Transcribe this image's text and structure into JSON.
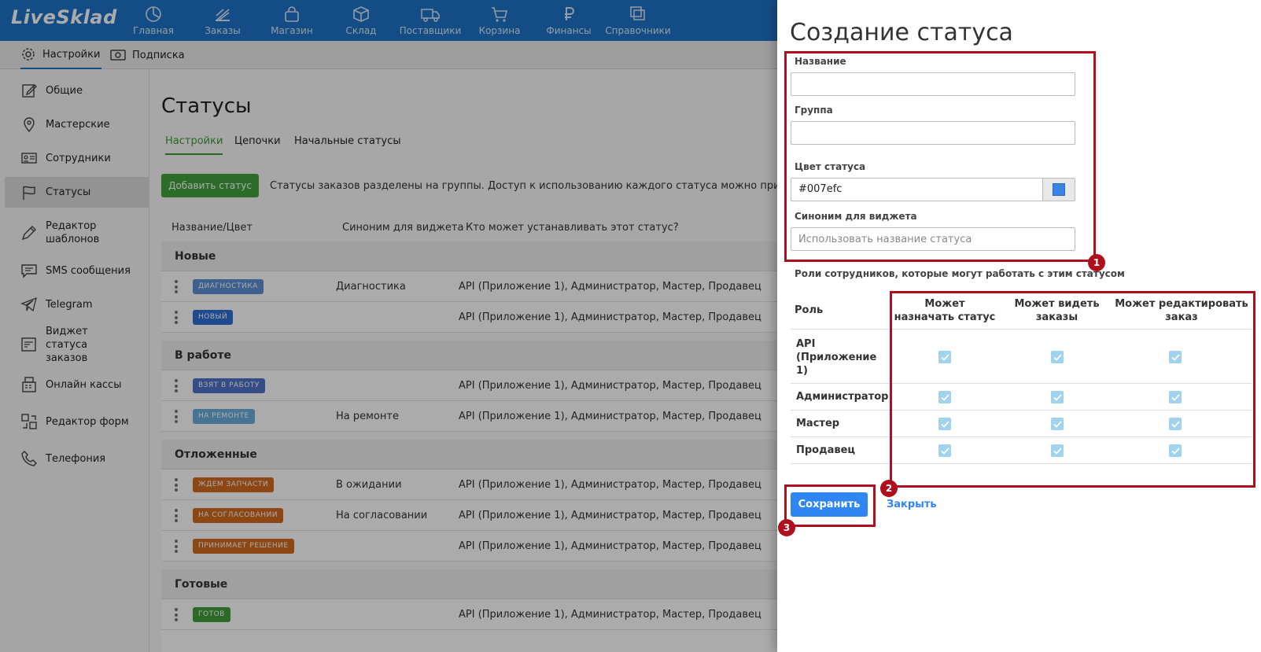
{
  "app": {
    "logo": "LiveSklad"
  },
  "topnav": [
    {
      "label": "Главная",
      "icon": "dashboard-icon"
    },
    {
      "label": "Заказы",
      "icon": "orders-icon"
    },
    {
      "label": "Магазин",
      "icon": "shop-bag-icon"
    },
    {
      "label": "Склад",
      "icon": "warehouse-box-icon"
    },
    {
      "label": "Поставщики",
      "icon": "truck-icon"
    },
    {
      "label": "Корзина",
      "icon": "cart-icon"
    },
    {
      "label": "Финансы",
      "icon": "ruble-icon"
    },
    {
      "label": "Справочники",
      "icon": "catalog-icon"
    }
  ],
  "subnav": [
    {
      "label": "Настройки",
      "icon": "gear-icon"
    },
    {
      "label": "Подписка",
      "icon": "money-icon"
    }
  ],
  "sidebar": [
    {
      "label": "Общие",
      "icon": "edit-icon"
    },
    {
      "label": "Мастерские",
      "icon": "map-pin-icon"
    },
    {
      "label": "Сотрудники",
      "icon": "id-card-icon"
    },
    {
      "label": "Статусы",
      "icon": "flag-icon"
    },
    {
      "label": "Редактор шаблонов",
      "icon": "pencil-icon"
    },
    {
      "label": "SMS сообщения",
      "icon": "message-icon"
    },
    {
      "label": "Telegram",
      "icon": "telegram-icon"
    },
    {
      "label": "Виджет статуса заказов",
      "icon": "widget-icon"
    },
    {
      "label": "Онлайн кассы",
      "icon": "cash-register-icon"
    },
    {
      "label": "Редактор форм",
      "icon": "form-editor-icon"
    },
    {
      "label": "Телефония",
      "icon": "phone-icon"
    }
  ],
  "main": {
    "title": "Статусы",
    "tabs": [
      "Настройки",
      "Цепочки",
      "Начальные статусы"
    ],
    "add_button": "Добавить статус",
    "hint": "Статусы заказов разделены на группы. Доступ к использованию каждого статуса можно привязать к рол",
    "columns": [
      "Название/Цвет",
      "Синоним для виджета",
      "Кто может устанавливать этот статус?"
    ],
    "groups": [
      {
        "name": "Новые",
        "rows": [
          {
            "badge": "ДИАГНОСТИКА",
            "color": "#5b8fd6",
            "synonym": "Диагностика",
            "who": "API (Приложение 1), Администратор, Мастер, Продавец"
          },
          {
            "badge": "НОВЫЙ",
            "color": "#2f6fd6",
            "synonym": "",
            "who": "API (Приложение 1), Администратор, Мастер, Продавец"
          }
        ]
      },
      {
        "name": "В работе",
        "rows": [
          {
            "badge": "ВЗЯТ В РАБОТУ",
            "color": "#4f73c9",
            "synonym": "",
            "who": "API (Приложение 1), Администратор, Мастер, Продавец"
          },
          {
            "badge": "НА РЕМОНТЕ",
            "color": "#6aaedf",
            "synonym": "На ремонте",
            "who": "API (Приложение 1), Администратор, Мастер, Продавец"
          }
        ]
      },
      {
        "name": "Отложенные",
        "rows": [
          {
            "badge": "ЖДЕМ ЗАПЧАСТИ",
            "color": "#d26a1e",
            "synonym": "В ожидании",
            "who": "API (Приложение 1), Администратор, Мастер, Продавец"
          },
          {
            "badge": "НА СОГЛАСОВАНИИ",
            "color": "#d26a1e",
            "synonym": "На согласовании",
            "who": "API (Приложение 1), Администратор, Мастер, Продавец"
          },
          {
            "badge": "ПРИНИМАЕТ РЕШЕНИЕ",
            "color": "#d26a1e",
            "synonym": "",
            "who": "API (Приложение 1), Администратор, Мастер, Продавец"
          }
        ]
      },
      {
        "name": "Готовые",
        "rows": [
          {
            "badge": "ГОТОВ",
            "color": "#3f9e3a",
            "synonym": "",
            "who": "API (Приложение 1), Администратор, Мастер, Продавец"
          }
        ]
      }
    ]
  },
  "panel": {
    "title": "Создание статуса",
    "name_label": "Название",
    "name_value": "",
    "group_label": "Группа",
    "group_value": "",
    "color_label": "Цвет статуса",
    "color_value": "#007efc",
    "synonym_label": "Синоним для виджета",
    "synonym_placeholder": "Использовать название статуса",
    "roles_title": "Роли сотрудников, которые могут работать с этим статусом",
    "roles_columns": [
      "Роль",
      "Может назначать статус",
      "Может видеть заказы",
      "Может редактировать заказ"
    ],
    "roles": [
      {
        "name": "API (Приложение 1)",
        "assign": true,
        "view": true,
        "edit": true
      },
      {
        "name": "Администратор",
        "assign": true,
        "view": true,
        "edit": true
      },
      {
        "name": "Мастер",
        "assign": true,
        "view": true,
        "edit": true
      },
      {
        "name": "Продавец",
        "assign": true,
        "view": true,
        "edit": true
      }
    ],
    "save_button": "Сохранить",
    "close_link": "Закрыть"
  },
  "annotations": [
    "1",
    "2",
    "3"
  ]
}
